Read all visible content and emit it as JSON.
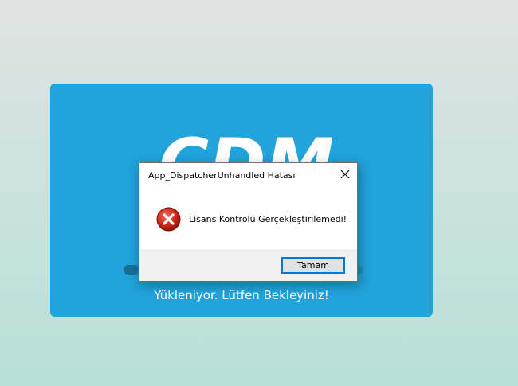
{
  "splash": {
    "logo_text": "CDM",
    "loading_text": "Yükleniyor. Lütfen Bekleyiniz!",
    "progress": 0.06,
    "background_color": "#21a3db"
  },
  "dialog": {
    "title": "App_DispatcherUnhandled Hatası",
    "message": "Lisans Kontrolü Gerçekleştirilemedi!",
    "ok_label": "Tamam",
    "close_icon": "close-icon",
    "status_icon": "error-icon",
    "error_color": "#c42b1c"
  }
}
